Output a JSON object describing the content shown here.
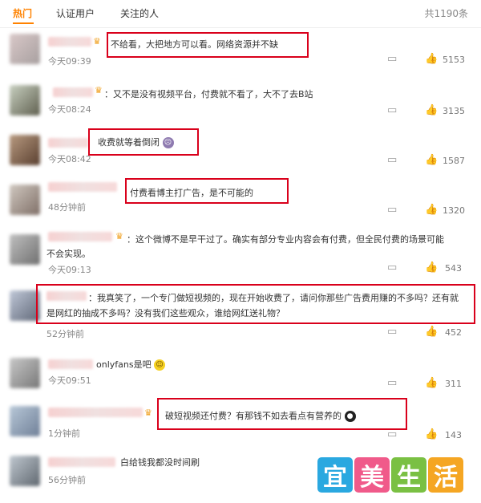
{
  "tabs": [
    "热门",
    "认证用户",
    "关注的人"
  ],
  "total": "共1190条",
  "comments": [
    {
      "text": "不给看，大把地方可以看。网络资源并不缺",
      "time": "今天09:39",
      "likes": "5153"
    },
    {
      "text": "：又不是没有视频平台，付费就不看了，大不了去B站",
      "time": "今天08:24",
      "likes": "3135"
    },
    {
      "text": "收费就等着倒闭",
      "time": "今天08:42",
      "likes": "1587"
    },
    {
      "text": "付费看博主打广告，是不可能的",
      "time": "48分钟前",
      "likes": "1320"
    },
    {
      "text": "：这个微博不是早干过了。确实有部分专业内容会有付费，但全民付费的场景可能",
      "text2": "不会实现。",
      "time": "今天09:13",
      "likes": "543"
    },
    {
      "text": "：我真笑了，一个专门做短视频的，现在开始收费了，请问你那些广告费用赚的不多吗？还有就",
      "text2": "是网红的抽成不多吗？没有我们这些观众，谁给网红送礼物？",
      "time": "52分钟前",
      "likes": "452"
    },
    {
      "text": "onlyfans是吧",
      "time": "今天09:51",
      "likes": "311"
    },
    {
      "text": "破短视频还付费？有那钱不如去看点有营养的",
      "time": "1分钟前",
      "likes": "143"
    },
    {
      "text": "白给钱我都没时间刷",
      "time": "56分钟前",
      "likes": ""
    }
  ],
  "watermark": [
    "宜",
    "美",
    "生",
    "活"
  ],
  "colors": {
    "accent": "#ff8200",
    "highlight_box": "#d9001b"
  }
}
